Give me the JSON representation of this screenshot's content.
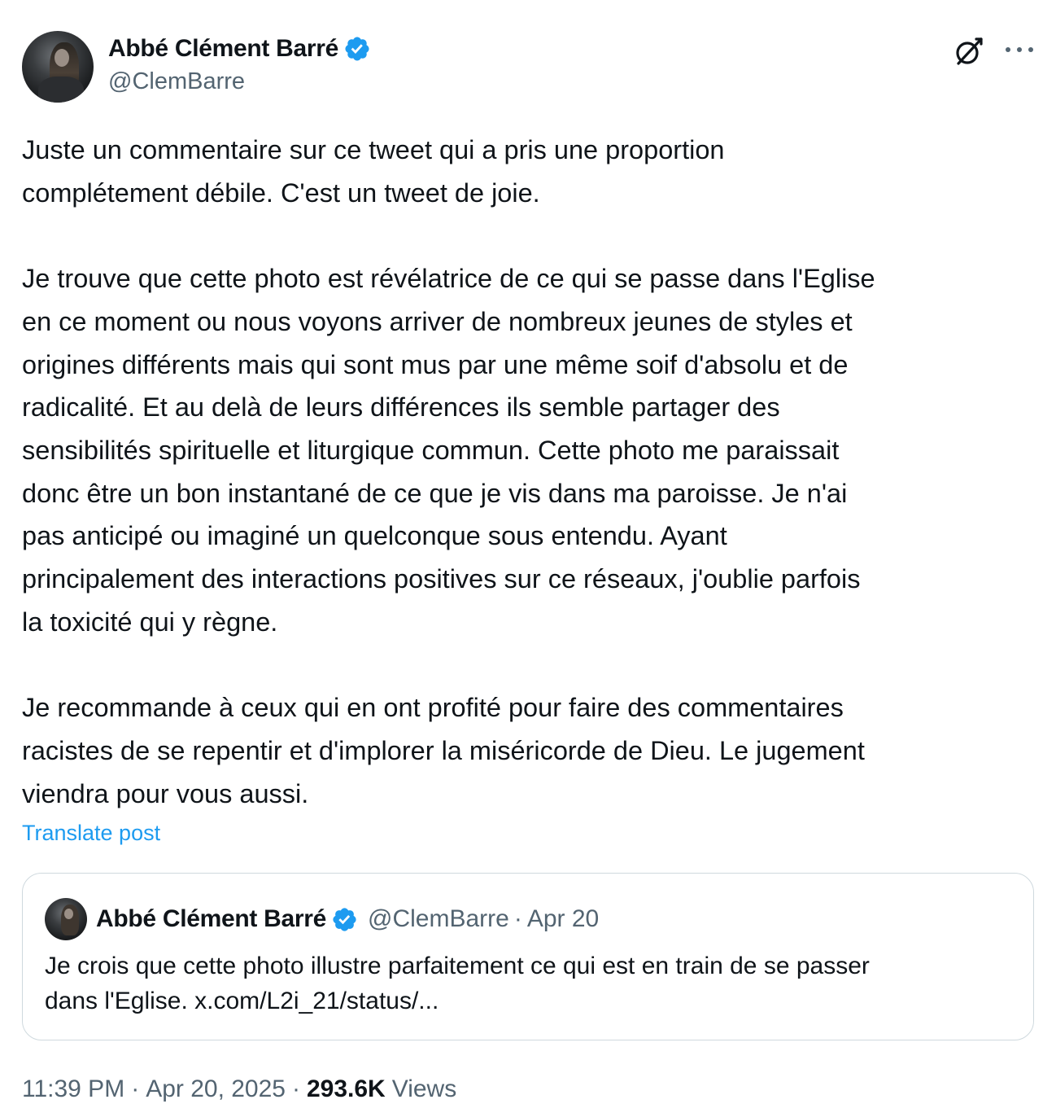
{
  "author": {
    "name": "Abbé Clément Barré",
    "handle": "@ClemBarre",
    "verified": true
  },
  "icons": {
    "verified": "verified-badge-icon",
    "grok": "grok-icon",
    "more": "more-icon"
  },
  "colors": {
    "accent": "#1d9bf0",
    "secondary_text": "#536471",
    "primary_text": "#0f1419",
    "border": "#cfd9de"
  },
  "post": {
    "lines": [
      "Juste un commentaire sur ce tweet qui a pris une proportion",
      "complétement débile. C'est un tweet de joie.",
      "",
      "Je trouve que cette photo est révélatrice de ce qui se passe dans l'Eglise",
      "en ce moment ou nous voyons arriver de nombreux jeunes de styles et",
      "origines différents mais qui sont mus par une même soif d'absolu et de",
      "radicalité. Et au delà de leurs différences ils semble partager des",
      "sensibilités spirituelle et liturgique commun. Cette photo me paraissait",
      "donc être un bon instantané de ce que je vis dans ma paroisse. Je n'ai",
      "pas anticipé ou imaginé un quelconque sous entendu. Ayant",
      "principalement des interactions positives sur ce réseaux, j'oublie parfois",
      "la toxicité qui y règne.",
      "",
      "Je recommande à ceux qui en ont profité pour faire des commentaires",
      "racistes de se repentir et d'implorer la miséricorde de Dieu. Le jugement",
      "viendra pour vous aussi."
    ],
    "translate_label": "Translate post"
  },
  "quoted": {
    "name": "Abbé Clément Barré",
    "handle": "@ClemBarre",
    "separator": "·",
    "date": "Apr 20",
    "lines": [
      "Je crois que cette photo illustre parfaitement ce qui est en train de se passer",
      "dans l'Eglise. x.com/L2i_21/status/..."
    ]
  },
  "meta": {
    "time": "11:39 PM",
    "sep1": "·",
    "date": "Apr 20, 2025",
    "sep2": "·",
    "views_count": "293.6K",
    "views_label": "Views"
  }
}
